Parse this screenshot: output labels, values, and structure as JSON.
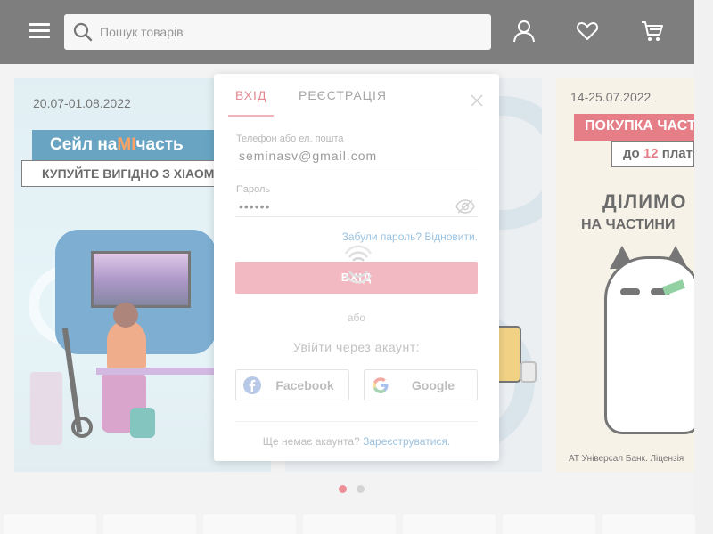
{
  "header": {
    "search_placeholder": "Пошук товарів"
  },
  "banners": {
    "left": {
      "date": "20.07-01.08.2022",
      "title_pre": "Сейл на",
      "title_mi": "MI",
      "title_post": "часть",
      "subtitle": "КУПУЙТЕ ВИГІДНО З ХІАОМІ"
    },
    "right": {
      "date": "14-25.07.2022",
      "title": "ПОКУПКА ЧАСТИНАМИ",
      "sub_pre": "до ",
      "sub_num": "12",
      "sub_post": " платежів",
      "big": "ДІЛИМО",
      "small": "НА ЧАСТИНИ",
      "footnote": "АТ Універсал Банк. Ліцензія"
    }
  },
  "carousel": {
    "active_color": "#e04a5a",
    "inactive_color": "#b9b9b9"
  },
  "modal": {
    "tab_login": "ВХІД",
    "tab_register": "РЕЄСТРАЦІЯ",
    "login_label": "Телефон або ел. пошта",
    "login_value": "seminasv@gmail.com",
    "password_label": "Пароль",
    "password_value": "••••••",
    "forgot": "Забули пароль? Відновити.",
    "login_button": "ВХІД",
    "or": "або",
    "via_account": "Увійти через акаунт:",
    "facebook": "Facebook",
    "google": "Google",
    "no_account": "Ще немає акаунта?",
    "register_link": "Зареєструватися."
  },
  "colors": {
    "header_bg": "#303030",
    "accent_pink": "#f3b9c3",
    "link_blue": "#9cc3e0"
  }
}
